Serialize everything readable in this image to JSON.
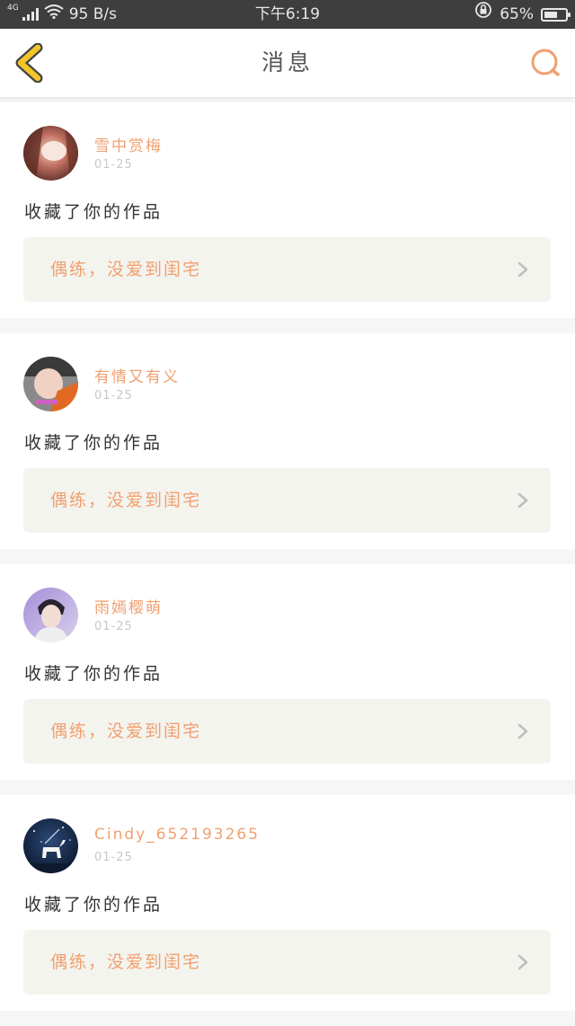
{
  "status_bar": {
    "network": "4G",
    "speed": "95 B/s",
    "time": "下午6:19",
    "battery_percent": "65%",
    "battery_level": 0.65,
    "icons": [
      "signal-icon",
      "wifi-icon",
      "rotation-lock-icon",
      "battery-icon"
    ]
  },
  "header": {
    "title": "消息",
    "back_icon": "chevron-left-icon",
    "search_icon": "search-icon"
  },
  "colors": {
    "accent": "#f0a070",
    "back_icon": "#f2c62a",
    "back_icon_outline": "#444444",
    "card_link_bg": "#f4f4ef",
    "page_bg": "#f6f6f6"
  },
  "messages": [
    {
      "username": "雪中赏梅",
      "date": "01-25",
      "action": "收藏了你的作品",
      "work_title": "偶练，没爱到闺宅",
      "avatar": "avatar-user-1"
    },
    {
      "username": "有情又有义",
      "date": "01-25",
      "action": "收藏了你的作品",
      "work_title": "偶练，没爱到闺宅",
      "avatar": "avatar-user-2"
    },
    {
      "username": "雨嫣樱萌",
      "date": "01-25",
      "action": "收藏了你的作品",
      "work_title": "偶练，没爱到闺宅",
      "avatar": "avatar-user-3"
    },
    {
      "username": "Cindy_652193265",
      "date": "01-25",
      "action": "收藏了你的作品",
      "work_title": "偶练，没爱到闺宅",
      "avatar": "avatar-user-4"
    }
  ]
}
